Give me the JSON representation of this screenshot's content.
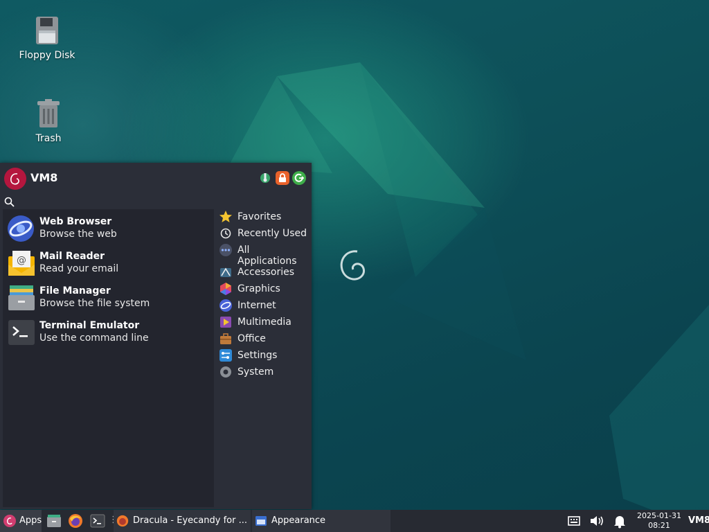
{
  "desktop": {
    "icons": [
      {
        "label": "Floppy Disk",
        "icon": "floppy-disk-icon"
      },
      {
        "label": "Trash",
        "icon": "trash-icon"
      }
    ]
  },
  "menu": {
    "user": "VM8",
    "header_buttons": [
      "settings-icon",
      "lock-icon",
      "logout-icon"
    ],
    "search": {
      "value": "",
      "placeholder": ""
    },
    "apps": [
      {
        "name": "Web Browser",
        "description": "Browse the web",
        "icon": "web-browser-icon"
      },
      {
        "name": "Mail Reader",
        "description": "Read your email",
        "icon": "mail-reader-icon"
      },
      {
        "name": "File Manager",
        "description": "Browse the file system",
        "icon": "file-manager-icon"
      },
      {
        "name": "Terminal Emulator",
        "description": "Use the command line",
        "icon": "terminal-icon"
      }
    ],
    "categories": [
      {
        "label": "Favorites",
        "icon": "star-icon"
      },
      {
        "label": "Recently Used",
        "icon": "clock-icon"
      },
      {
        "label": "All Applications",
        "icon": "dots-icon"
      },
      {
        "label": "Accessories",
        "icon": "accessories-icon"
      },
      {
        "label": "Graphics",
        "icon": "graphics-icon"
      },
      {
        "label": "Internet",
        "icon": "internet-icon"
      },
      {
        "label": "Multimedia",
        "icon": "multimedia-icon"
      },
      {
        "label": "Office",
        "icon": "office-icon"
      },
      {
        "label": "Settings",
        "icon": "settings-icon"
      },
      {
        "label": "System",
        "icon": "system-icon"
      }
    ]
  },
  "taskbar": {
    "apps_label": "Apps",
    "windows": [
      {
        "title": "Dracula - Eyecandy for ...",
        "icon": "firefox-icon"
      },
      {
        "title": "Appearance",
        "icon": "appearance-icon"
      }
    ],
    "clock": {
      "date": "2025-01-31",
      "time": "08:21"
    },
    "user": "VM8"
  },
  "colors": {
    "accent": "#b5163e",
    "menu_bg": "#2b2e38",
    "taskbar_bg": "#272a32"
  }
}
